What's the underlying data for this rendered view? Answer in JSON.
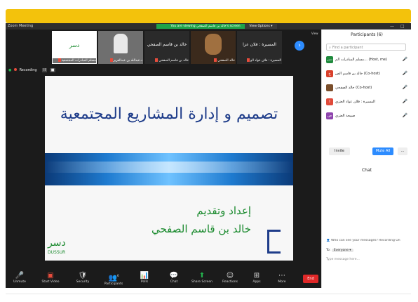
{
  "window": {
    "app_title": "Zoom Meeting",
    "banner": "You are viewing خالد بن قاسم الصفحي's screen",
    "view_options": "View Options ▾",
    "controls": [
      "—",
      "□"
    ]
  },
  "strip": {
    "tiles": [
      {
        "display": "دسر",
        "label": "مسلم المبادرات المجتمعية"
      },
      {
        "display": "",
        "label": "د.عبدالله بن عبدالعزيز"
      },
      {
        "display": "خالد بن قاسم الصفحي",
        "label": "خالد بن قاسم الصفحي"
      },
      {
        "display": "",
        "label": "خالد الصفحي"
      },
      {
        "display": "المسيرة : فلان عزا",
        "label": "المسيرة : فلان عواد الو"
      }
    ],
    "nav": "›",
    "view": "View"
  },
  "recording": {
    "label": "Recording",
    "pause": "II",
    "stop": "■"
  },
  "slide": {
    "title": "تصميم و إدارة المشاريع المجتمعية",
    "prepared": "إعداد وتقديم",
    "presenter": "خالد بن قاسم الصفحي",
    "logo": "دسر",
    "logo_sub": "DUSSUR"
  },
  "toolbar": {
    "items": [
      {
        "icon": "🎤",
        "label": "Unmute",
        "color": "red"
      },
      {
        "icon": "▣",
        "label": "Start Video",
        "color": "red"
      },
      {
        "icon": "🛡",
        "label": "Security"
      },
      {
        "icon": "👥",
        "label": "Participants",
        "badge": "6"
      },
      {
        "icon": "📊",
        "label": "Polls"
      },
      {
        "icon": "💬",
        "label": "Chat"
      },
      {
        "icon": "⬆",
        "label": "Share Screen",
        "color": "green"
      },
      {
        "icon": "☺",
        "label": "Reactions"
      },
      {
        "icon": "⊞",
        "label": "Apps"
      },
      {
        "icon": "⋯",
        "label": "More"
      }
    ],
    "end": "End"
  },
  "participants": {
    "header": "Participants (6)",
    "search_placeholder": "Find a participant",
    "list": [
      {
        "initial": "دسر",
        "name": "مسلم المبادرات الم... (Host, me)",
        "color": "#1f8a3d"
      },
      {
        "initial": "خ",
        "name": "خالد بن قاسم الص (Co-host)",
        "color": "#d9402b"
      },
      {
        "initial": "",
        "name": "خالد الصفحي (Co-host)",
        "color": "#7a4e2b"
      },
      {
        "initial": "ا",
        "name": "المسيرة : فلان عواد العنزي",
        "color": "#e04a3a"
      },
      {
        "initial": "ص",
        "name": "صبيحة العنزي",
        "color": "#8e44ad"
      }
    ],
    "invite": "Invite",
    "mute_all": "Mute All",
    "more": "..."
  },
  "chat": {
    "header": "Chat",
    "who_can_see": "Who can see your messages? Recording On",
    "to_label": "To:",
    "to_value": "Everyone ▾",
    "placeholder": "Type message here..."
  }
}
